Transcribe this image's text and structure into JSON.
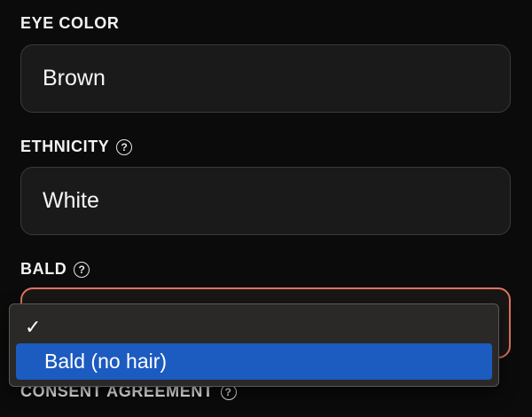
{
  "eye_color": {
    "label": "EYE COLOR",
    "value": "Brown"
  },
  "ethnicity": {
    "label": "ETHNICITY",
    "value": "White",
    "help_icon": "help-circle-icon"
  },
  "bald": {
    "label": "BALD",
    "help_icon": "help-circle-icon",
    "value": "",
    "accent_color": "#e0735d",
    "dropdown": {
      "options": [
        {
          "label": "",
          "checked": true
        },
        {
          "label": "Bald (no hair)",
          "highlighted": true
        }
      ],
      "highlight_color": "#1c5bc0"
    }
  },
  "consent": {
    "label": "CONSENT AGREEMENT",
    "help_icon": "help-circle-icon"
  }
}
